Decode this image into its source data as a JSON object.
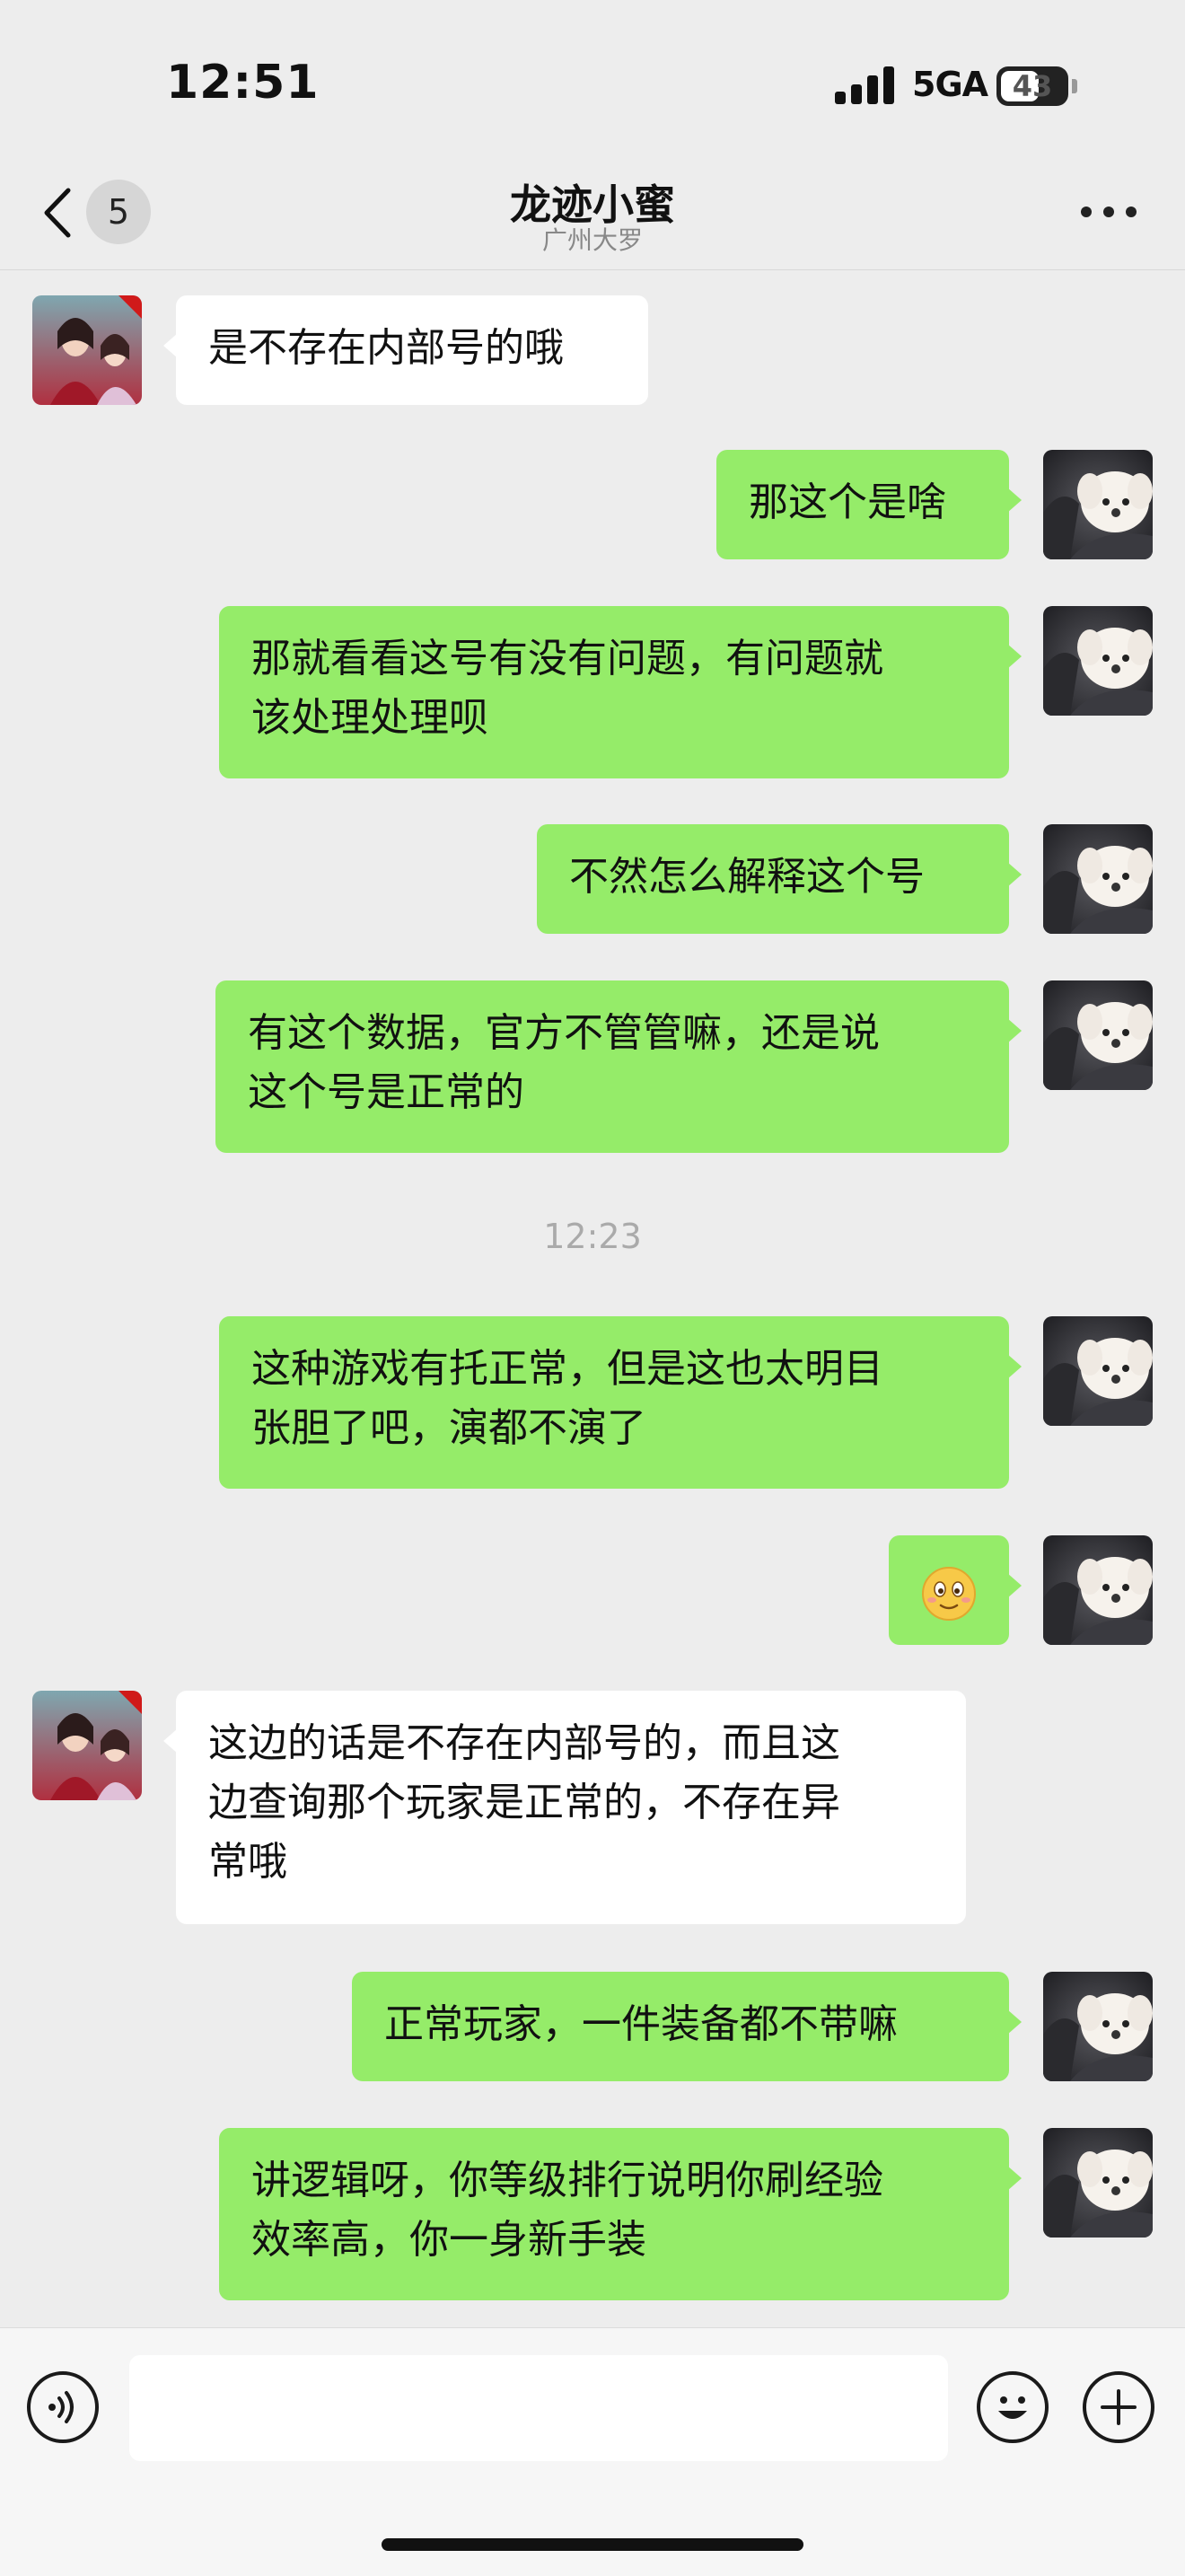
{
  "status": {
    "time": "12:51",
    "network": "5GA",
    "battery": "43"
  },
  "nav": {
    "back_count": "5",
    "title": "龙迹小蜜",
    "subtitle": "广州大罗"
  },
  "messages": [
    {
      "text": "是不存在内部号的哦"
    },
    {
      "text": "那这个是啥"
    },
    {
      "lines": [
        "那就看看这号有没有问题，有问题就",
        "该处理处理呗"
      ]
    },
    {
      "text": "不然怎么解释这个号"
    },
    {
      "lines": [
        "有这个数据，官方不管管嘛，还是说",
        "这个号是正常的"
      ]
    },
    {
      "time": "12:23"
    },
    {
      "lines": [
        "这种游戏有托正常，但是这也太明目",
        "张胆了吧，演都不演了"
      ]
    },
    {
      "emoji": "smiling-face-icon"
    },
    {
      "lines": [
        "这边的话是不存在内部号的，而且这",
        "边查询那个玩家是正常的，不存在异",
        "常哦"
      ]
    },
    {
      "text": "正常玩家，一件装备都不带嘛"
    },
    {
      "lines": [
        "讲逻辑呀，你等级排行说明你刷经验",
        "效率高，你一身新手装"
      ]
    }
  ],
  "input": {
    "placeholder": ""
  },
  "colors": {
    "sent_bubble": "#95ec69",
    "received_bubble": "#ffffff",
    "background": "#ededed"
  }
}
